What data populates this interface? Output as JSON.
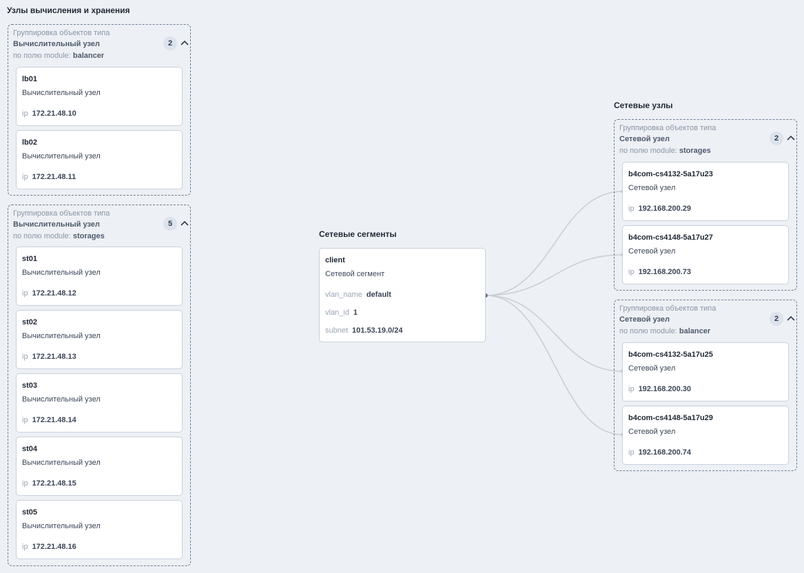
{
  "compute_section": {
    "title": "Узлы вычисления и хранения",
    "groups": [
      {
        "caption": "Группировка объектов типа",
        "type": "Вычислительный узел",
        "field_prefix": "по полю module:",
        "field_value": "balancer",
        "count": "2",
        "nodes": [
          {
            "name": "lb01",
            "type": "Вычислительный узел",
            "prop_key": "ip",
            "prop_value": "172.21.48.10"
          },
          {
            "name": "lb02",
            "type": "Вычислительный узел",
            "prop_key": "ip",
            "prop_value": "172.21.48.11"
          }
        ]
      },
      {
        "caption": "Группировка объектов типа",
        "type": "Вычислительный узел",
        "field_prefix": "по полю module:",
        "field_value": "storages",
        "count": "5",
        "nodes": [
          {
            "name": "st01",
            "type": "Вычислительный узел",
            "prop_key": "ip",
            "prop_value": "172.21.48.12"
          },
          {
            "name": "st02",
            "type": "Вычислительный узел",
            "prop_key": "ip",
            "prop_value": "172.21.48.13"
          },
          {
            "name": "st03",
            "type": "Вычислительный узел",
            "prop_key": "ip",
            "prop_value": "172.21.48.14"
          },
          {
            "name": "st04",
            "type": "Вычислительный узел",
            "prop_key": "ip",
            "prop_value": "172.21.48.15"
          },
          {
            "name": "st05",
            "type": "Вычислительный узел",
            "prop_key": "ip",
            "prop_value": "172.21.48.16"
          }
        ]
      }
    ]
  },
  "segments_section": {
    "title": "Сетевые сегменты",
    "segment": {
      "name": "client",
      "type": "Сетевой сегмент",
      "props": [
        {
          "key": "vlan_name",
          "value": "default"
        },
        {
          "key": "vlan_id",
          "value": "1"
        },
        {
          "key": "subnet",
          "value": "101.53.19.0/24"
        }
      ]
    }
  },
  "network_section": {
    "title": "Сетевые узлы",
    "groups": [
      {
        "caption": "Группировка объектов типа",
        "type": "Сетевой узел",
        "field_prefix": "по полю module:",
        "field_value": "storages",
        "count": "2",
        "nodes": [
          {
            "name": "b4com-cs4132-5a17u23",
            "type": "Сетевой узел",
            "prop_key": "ip",
            "prop_value": "192.168.200.29"
          },
          {
            "name": "b4com-cs4148-5a17u27",
            "type": "Сетевой узел",
            "prop_key": "ip",
            "prop_value": "192.168.200.73"
          }
        ]
      },
      {
        "caption": "Группировка объектов типа",
        "type": "Сетевой узел",
        "field_prefix": "по полю module:",
        "field_value": "balancer",
        "count": "2",
        "nodes": [
          {
            "name": "b4com-cs4132-5a17u25",
            "type": "Сетевой узел",
            "prop_key": "ip",
            "prop_value": "192.168.200.30"
          },
          {
            "name": "b4com-cs4148-5a17u29",
            "type": "Сетевой узел",
            "prop_key": "ip",
            "prop_value": "192.168.200.74"
          }
        ]
      }
    ]
  },
  "icons": {
    "group_toggle": "chevron-up-icon"
  },
  "colors": {
    "background": "#edf0f4",
    "edge": "#c8cdd4",
    "group_border": "#6b7d96"
  }
}
